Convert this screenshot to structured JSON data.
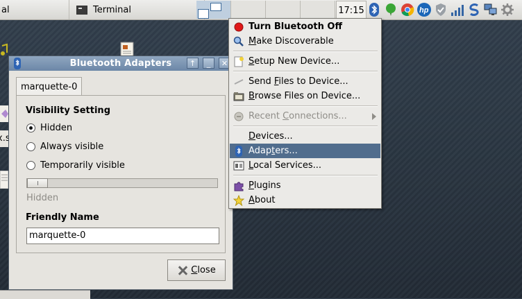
{
  "taskbar": {
    "left_task_label": "al",
    "terminal_label": "Terminal",
    "clock": "17:15",
    "tray_icons": [
      "bluetooth-icon",
      "green-balloon-icon",
      "chrome-icon",
      "hp-icon",
      "shield-check-icon",
      "signal-bars-icon",
      "sync-s-icon",
      "network-computers-icon",
      "settings-gear-icon"
    ]
  },
  "desktop": {
    "partial_label": "x.s"
  },
  "dialog": {
    "title": "Bluetooth Adapters",
    "tab": "marquette-0",
    "visibility_heading": "Visibility Setting",
    "options": [
      "Hidden",
      "Always visible",
      "Temporarily visible"
    ],
    "selected_option": "Hidden",
    "slider_value": 0,
    "slider_label": "Hidden",
    "friendly_name_heading": "Friendly Name",
    "friendly_name_value": "marquette-0",
    "close_mnemonic": "C",
    "close_rest": "lose"
  },
  "menu": {
    "turn_off": "Turn Bluetooth Off",
    "discoverable_m": "M",
    "discoverable_rest": "ake Discoverable",
    "setup_s": "S",
    "setup_rest": "etup New Device...",
    "send_a": "Send ",
    "send_f": "F",
    "send_b": "iles to Device...",
    "browse_b": "B",
    "browse_rest": "rowse Files on Device...",
    "recent_a": "Recent ",
    "recent_c": "C",
    "recent_b": "onnections...",
    "devices_d": "D",
    "devices_rest": "evices...",
    "adapters_a": "Adap",
    "adapters_t": "t",
    "adapters_b": "ers...",
    "local_l": "L",
    "local_rest": "ocal Services...",
    "plugins_p": "P",
    "plugins_rest": "lugins",
    "about_a": "A",
    "about_rest": "bout"
  },
  "colors": {
    "menu_highlight": "#516d8d",
    "titlebar": "#6c87a7",
    "turn_off_dot": "#e01818"
  }
}
